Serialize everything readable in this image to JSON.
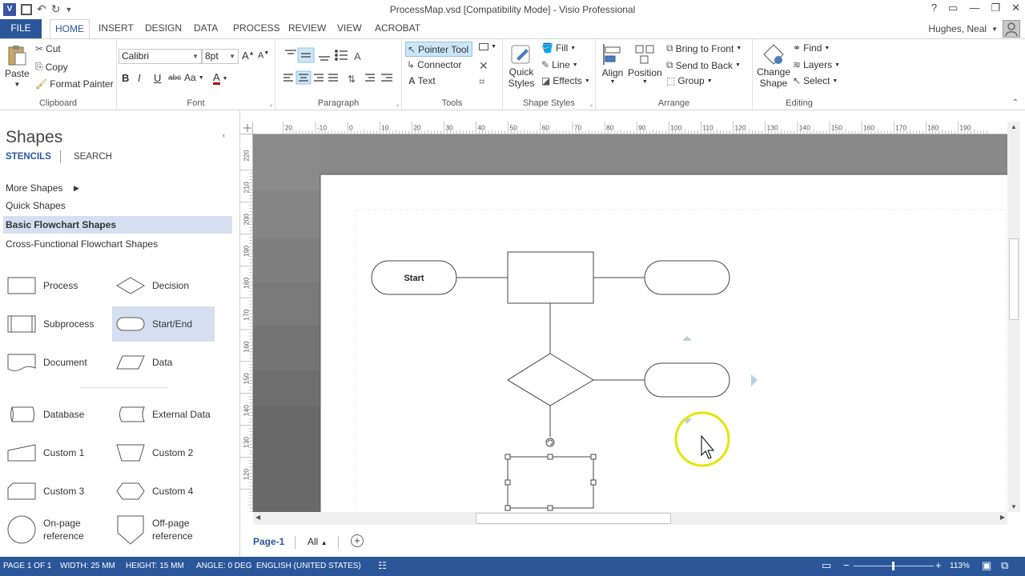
{
  "window": {
    "title": "ProcessMap.vsd  [Compatibility Mode] - Visio Professional",
    "help": "?",
    "minimize": "—",
    "restore": "❐",
    "close": "✕"
  },
  "tabs": [
    "FILE",
    "HOME",
    "INSERT",
    "DESIGN",
    "DATA",
    "PROCESS",
    "REVIEW",
    "VIEW",
    "ACROBAT"
  ],
  "active_tab": "HOME",
  "user": {
    "name": "Hughes, Neal"
  },
  "ribbon": {
    "clipboard": {
      "label": "Clipboard",
      "paste": "Paste",
      "cut": "Cut",
      "copy": "Copy",
      "format_painter": "Format Painter"
    },
    "font": {
      "label": "Font",
      "family": "Calibri",
      "size": "8pt",
      "bold": "B",
      "italic": "I",
      "underline": "U",
      "strike": "abc",
      "case": "Aa",
      "color": "A"
    },
    "paragraph": {
      "label": "Paragraph"
    },
    "tools": {
      "label": "Tools",
      "pointer": "Pointer Tool",
      "connector": "Connector",
      "text": "Text"
    },
    "shape_styles": {
      "label": "Shape Styles",
      "quick_styles": "Quick Styles",
      "fill": "Fill",
      "line": "Line",
      "effects": "Effects"
    },
    "arrange": {
      "label": "Arrange",
      "align": "Align",
      "position": "Position",
      "bring_front": "Bring to Front",
      "send_back": "Send to Back",
      "group": "Group"
    },
    "editing": {
      "label": "Editing",
      "change_shape": "Change Shape",
      "find": "Find",
      "layers": "Layers",
      "select": "Select"
    }
  },
  "shapes_pane": {
    "title": "Shapes",
    "nav": [
      "STENCILS",
      "SEARCH"
    ],
    "stencils": [
      "More Shapes",
      "Quick Shapes",
      "Basic Flowchart Shapes",
      "Cross-Functional Flowchart Shapes"
    ],
    "selected_stencil": "Basic Flowchart Shapes",
    "shapes": [
      {
        "label": "Process",
        "icon": "process-shape"
      },
      {
        "label": "Decision",
        "icon": "decision-shape"
      },
      {
        "label": "Subprocess",
        "icon": "subprocess-shape"
      },
      {
        "label": "Start/End",
        "icon": "start-end-shape"
      },
      {
        "label": "Document",
        "icon": "document-shape"
      },
      {
        "label": "Data",
        "icon": "data-shape"
      },
      {
        "label": "Database",
        "icon": "database-shape"
      },
      {
        "label": "External Data",
        "icon": "external-data-shape"
      },
      {
        "label": "Custom 1",
        "icon": "custom1-shape"
      },
      {
        "label": "Custom 2",
        "icon": "custom2-shape"
      },
      {
        "label": "Custom 3",
        "icon": "custom3-shape"
      },
      {
        "label": "Custom 4",
        "icon": "custom4-shape"
      },
      {
        "label": "On-page reference",
        "icon": "on-page-reference-shape"
      },
      {
        "label": "Off-page reference",
        "icon": "off-page-reference-shape"
      }
    ],
    "selected_shape": "Start/End"
  },
  "rulers": {
    "horizontal": [
      "20",
      "-10",
      "0",
      "10",
      "20",
      "30",
      "40",
      "50",
      "60",
      "70",
      "80",
      "90",
      "100",
      "110",
      "120",
      "130",
      "140",
      "150",
      "160",
      "170",
      "180",
      "190"
    ],
    "vertical": [
      "220",
      "210",
      "200",
      "190",
      "180",
      "170",
      "160",
      "150",
      "140",
      "130",
      "120"
    ]
  },
  "diagram": {
    "start_label": "Start"
  },
  "page_tabs": {
    "page": "Page-1",
    "all": "All"
  },
  "status": {
    "page": "PAGE 1 OF 1",
    "width": "WIDTH: 25 MM",
    "height": "HEIGHT: 15 MM",
    "angle": "ANGLE: 0 DEG",
    "language": "ENGLISH (UNITED STATES)",
    "zoom": "113%"
  },
  "colors": {
    "accent": "#2b579a",
    "canvas": "#7f7f7f",
    "selection": "#d5dff0",
    "highlight": "#ffff00"
  }
}
